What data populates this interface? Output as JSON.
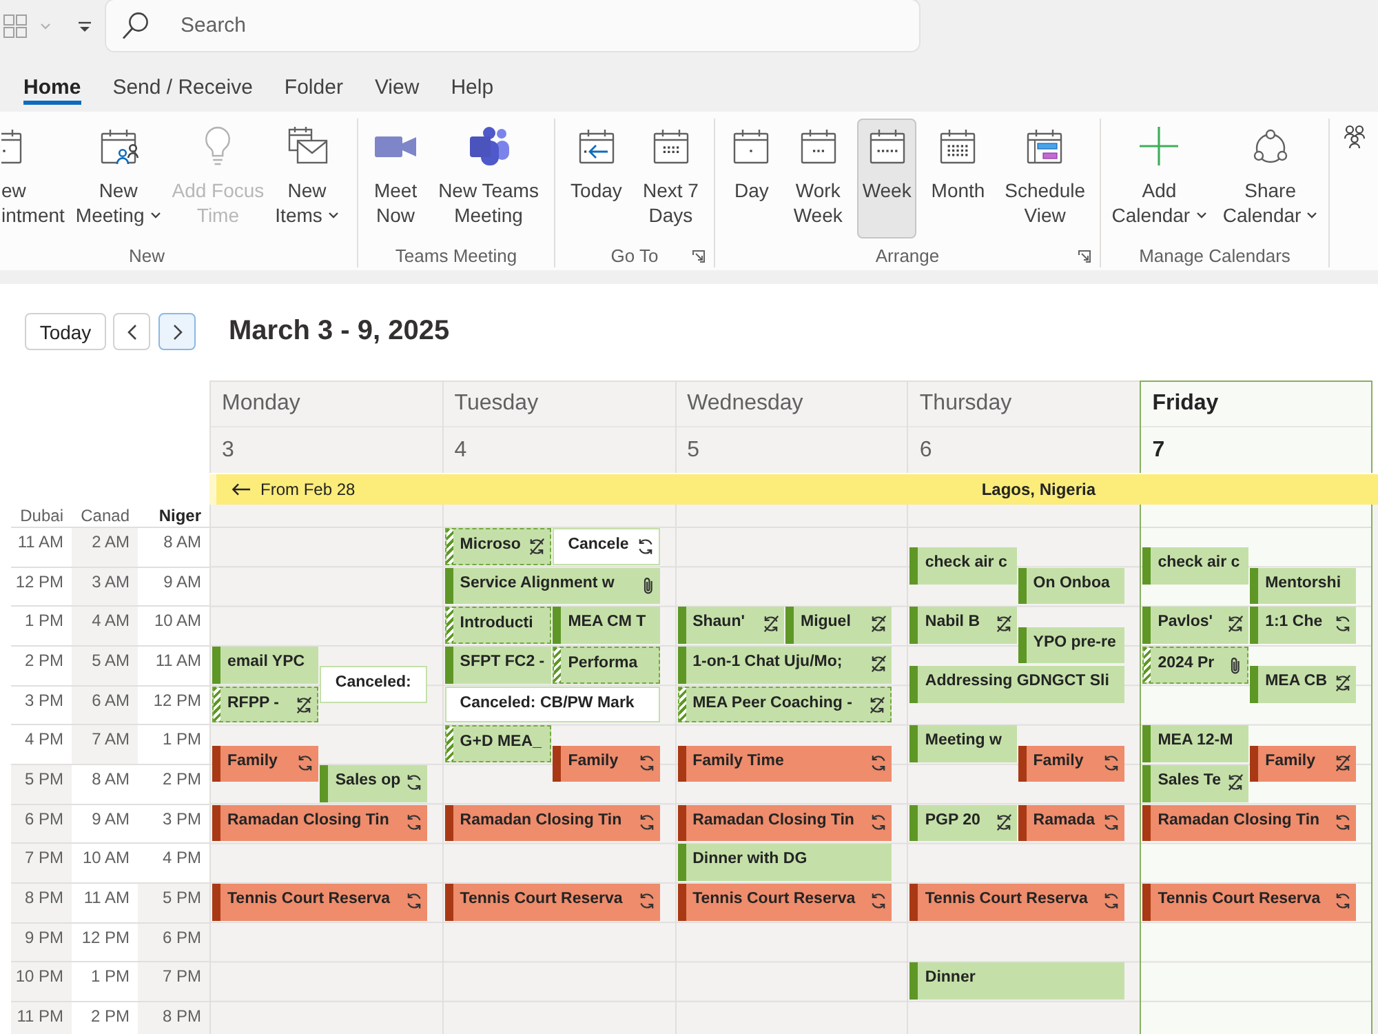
{
  "top_bar": {
    "search": {
      "placeholder": "Search"
    }
  },
  "tabs": [
    {
      "label": "Home",
      "selected": true
    },
    {
      "label": "Send / Receive",
      "selected": false
    },
    {
      "label": "Folder",
      "selected": false
    },
    {
      "label": "View",
      "selected": false
    },
    {
      "label": "Help",
      "selected": false
    }
  ],
  "ribbon": {
    "groups": [
      {
        "label": "New",
        "launcher": false,
        "buttons": [
          {
            "lines": [
              "ew",
              "intment"
            ],
            "dropdown": false,
            "disabled": false
          },
          {
            "lines": [
              "New",
              "Meeting"
            ],
            "dropdown": true,
            "disabled": false
          },
          {
            "lines": [
              "Add Focus",
              "Time"
            ],
            "dropdown": false,
            "disabled": true
          },
          {
            "lines": [
              "New",
              "Items"
            ],
            "dropdown": true,
            "disabled": false
          }
        ]
      },
      {
        "label": "Teams Meeting",
        "launcher": false,
        "buttons": [
          {
            "lines": [
              "Meet",
              "Now"
            ],
            "dropdown": false,
            "disabled": false
          },
          {
            "lines": [
              "New Teams",
              "Meeting"
            ],
            "dropdown": false,
            "disabled": false
          }
        ]
      },
      {
        "label": "Go To",
        "launcher": true,
        "buttons": [
          {
            "lines": [
              "Today"
            ],
            "dropdown": false,
            "disabled": false
          },
          {
            "lines": [
              "Next 7",
              "Days"
            ],
            "dropdown": false,
            "disabled": false
          }
        ]
      },
      {
        "label": "Arrange",
        "launcher": true,
        "buttons": [
          {
            "lines": [
              "Day"
            ],
            "dropdown": false,
            "disabled": false,
            "selected": false
          },
          {
            "lines": [
              "Work",
              "Week"
            ],
            "dropdown": false,
            "disabled": false,
            "selected": false
          },
          {
            "lines": [
              "Week"
            ],
            "dropdown": false,
            "disabled": false,
            "selected": true
          },
          {
            "lines": [
              "Month"
            ],
            "dropdown": false,
            "disabled": false,
            "selected": false
          },
          {
            "lines": [
              "Schedule",
              "View"
            ],
            "dropdown": false,
            "disabled": false,
            "selected": false
          }
        ]
      },
      {
        "label": "Manage Calendars",
        "launcher": false,
        "buttons": [
          {
            "lines": [
              "Add",
              "Calendar"
            ],
            "dropdown": true,
            "disabled": false
          },
          {
            "lines": [
              "Share",
              "Calendar"
            ],
            "dropdown": true,
            "disabled": false
          }
        ]
      }
    ]
  },
  "calendar": {
    "nav": {
      "today": "Today",
      "arrows": [
        {
          "kind": "previous",
          "highlighted": false
        },
        {
          "kind": "next",
          "highlighted": true
        }
      ]
    },
    "title": "March 3 - 9, 2025",
    "all_day_events": [
      {
        "continued_label": "From Feb 28",
        "title": "Lagos, Nigeria",
        "color": "#fcec7a"
      }
    ],
    "time_zones": [
      {
        "name": "Dubai",
        "primary": false,
        "hours": [
          {
            "label": "11 AM",
            "working": true
          },
          {
            "label": "12 PM",
            "working": true
          },
          {
            "label": "1 PM",
            "working": true
          },
          {
            "label": "2 PM",
            "working": true
          },
          {
            "label": "3 PM",
            "working": true
          },
          {
            "label": "4 PM",
            "working": true
          },
          {
            "label": "5 PM",
            "working": false
          },
          {
            "label": "6 PM",
            "working": false
          },
          {
            "label": "7 PM",
            "working": false
          },
          {
            "label": "8 PM",
            "working": false
          },
          {
            "label": "9 PM",
            "working": false
          },
          {
            "label": "10 PM",
            "working": false
          },
          {
            "label": "11 PM",
            "working": false
          }
        ]
      },
      {
        "name": "Canad",
        "primary": false,
        "hours": [
          {
            "label": "2 AM",
            "working": false
          },
          {
            "label": "3 AM",
            "working": false
          },
          {
            "label": "4 AM",
            "working": false
          },
          {
            "label": "5 AM",
            "working": false
          },
          {
            "label": "6 AM",
            "working": false
          },
          {
            "label": "7 AM",
            "working": false
          },
          {
            "label": "8 AM",
            "working": true
          },
          {
            "label": "9 AM",
            "working": true
          },
          {
            "label": "10 AM",
            "working": true
          },
          {
            "label": "11 AM",
            "working": true
          },
          {
            "label": "12 PM",
            "working": true
          },
          {
            "label": "1 PM",
            "working": true
          },
          {
            "label": "2 PM",
            "working": true
          }
        ]
      },
      {
        "name": "Niger",
        "primary": true,
        "hours": [
          {
            "label": "8 AM",
            "working": true
          },
          {
            "label": "9 AM",
            "working": true
          },
          {
            "label": "10 AM",
            "working": true
          },
          {
            "label": "11 AM",
            "working": true
          },
          {
            "label": "12 PM",
            "working": true
          },
          {
            "label": "1 PM",
            "working": true
          },
          {
            "label": "2 PM",
            "working": true
          },
          {
            "label": "3 PM",
            "working": true
          },
          {
            "label": "4 PM",
            "working": true
          },
          {
            "label": "5 PM",
            "working": false
          },
          {
            "label": "6 PM",
            "working": false
          },
          {
            "label": "7 PM",
            "working": false
          },
          {
            "label": "8 PM",
            "working": false
          }
        ]
      }
    ],
    "days": [
      {
        "name": "Monday",
        "date": "3",
        "today": false,
        "events": [
          {
            "title": "email YPC",
            "kind": "busy",
            "color": "#c4e0a8"
          },
          {
            "title": "Canceled:",
            "kind": "canceled",
            "color": "#c4e0a8"
          },
          {
            "title": "RFPP -",
            "kind": "tentative",
            "color": "#c4e0a8",
            "exception": true
          },
          {
            "title": "Family",
            "kind": "busy",
            "color": "#ee8c6c",
            "recurring": true
          },
          {
            "title": "Sales op",
            "kind": "busy",
            "color": "#c4e0a8",
            "recurring": true
          },
          {
            "title": "Ramadan Closing Tin",
            "kind": "busy",
            "color": "#ee8c6c",
            "recurring": true
          },
          {
            "title": "Tennis Court Reserva",
            "kind": "busy",
            "color": "#ee8c6c",
            "recurring": true
          }
        ]
      },
      {
        "name": "Tuesday",
        "date": "4",
        "today": false,
        "events": [
          {
            "title": "Microso",
            "kind": "tentative",
            "color": "#c4e0a8",
            "exception": true
          },
          {
            "title": "Cancele",
            "kind": "canceled",
            "color": "#c4e0a8",
            "recurring": true
          },
          {
            "title": "Service Alignment w",
            "kind": "busy",
            "color": "#c4e0a8",
            "attachment": true
          },
          {
            "title": "Introducti",
            "kind": "tentative",
            "color": "#c4e0a8"
          },
          {
            "title": "MEA CM T",
            "kind": "busy",
            "color": "#c4e0a8"
          },
          {
            "title": "SFPT FC2 -",
            "kind": "busy",
            "color": "#c4e0a8"
          },
          {
            "title": "Performa",
            "kind": "tentative",
            "color": "#c4e0a8"
          },
          {
            "title": "Canceled: CB/PW Mark",
            "kind": "canceled",
            "color": "#c4e0a8"
          },
          {
            "title": "G+D MEA_",
            "kind": "tentative",
            "color": "#c4e0a8"
          },
          {
            "title": "Family",
            "kind": "busy",
            "color": "#ee8c6c",
            "recurring": true
          },
          {
            "title": "Ramadan Closing Tin",
            "kind": "busy",
            "color": "#ee8c6c",
            "recurring": true
          },
          {
            "title": "Tennis Court Reserva",
            "kind": "busy",
            "color": "#ee8c6c",
            "recurring": true
          }
        ]
      },
      {
        "name": "Wednesday",
        "date": "5",
        "today": false,
        "events": [
          {
            "title": "Shaun'",
            "kind": "busy",
            "color": "#c4e0a8",
            "exception": true
          },
          {
            "title": "Miguel",
            "kind": "busy",
            "color": "#c4e0a8",
            "exception": true
          },
          {
            "title": "1-on-1 Chat Uju/Mo;",
            "kind": "busy",
            "color": "#c4e0a8",
            "exception": true
          },
          {
            "title": "MEA Peer Coaching -",
            "kind": "tentative",
            "color": "#c4e0a8",
            "exception": true
          },
          {
            "title": "Family Time",
            "kind": "busy",
            "color": "#ee8c6c",
            "recurring": true
          },
          {
            "title": "Ramadan Closing Tin",
            "kind": "busy",
            "color": "#ee8c6c",
            "recurring": true
          },
          {
            "title": "Dinner with DG",
            "kind": "busy",
            "color": "#c4e0a8"
          },
          {
            "title": "Tennis Court Reserva",
            "kind": "busy",
            "color": "#ee8c6c",
            "recurring": true
          }
        ]
      },
      {
        "name": "Thursday",
        "date": "6",
        "today": false,
        "events": [
          {
            "title": "check air c",
            "kind": "busy",
            "color": "#c4e0a8"
          },
          {
            "title": "On Onboa",
            "kind": "busy",
            "color": "#c4e0a8"
          },
          {
            "title": "Nabil B",
            "kind": "busy",
            "color": "#c4e0a8",
            "exception": true
          },
          {
            "title": "YPO pre-re",
            "kind": "busy",
            "color": "#c4e0a8"
          },
          {
            "title": "Addressing GDNGCT Sli",
            "kind": "busy",
            "color": "#c4e0a8"
          },
          {
            "title": "Meeting w",
            "kind": "busy",
            "color": "#c4e0a8"
          },
          {
            "title": "Family",
            "kind": "busy",
            "color": "#ee8c6c",
            "recurring": true
          },
          {
            "title": "PGP 20",
            "kind": "busy",
            "color": "#c4e0a8",
            "exception": true
          },
          {
            "title": "Ramada",
            "kind": "busy",
            "color": "#ee8c6c",
            "recurring": true
          },
          {
            "title": "Tennis Court Reserva",
            "kind": "busy",
            "color": "#ee8c6c",
            "recurring": true
          },
          {
            "title": "Dinner",
            "kind": "busy",
            "color": "#c4e0a8"
          }
        ]
      },
      {
        "name": "Friday",
        "date": "7",
        "today": true,
        "events": [
          {
            "title": "check air c",
            "kind": "busy",
            "color": "#c4e0a8"
          },
          {
            "title": "Mentorshi",
            "kind": "busy",
            "color": "#c4e0a8"
          },
          {
            "title": "Pavlos'",
            "kind": "busy",
            "color": "#c4e0a8",
            "exception": true
          },
          {
            "title": "1:1 Che",
            "kind": "busy",
            "color": "#c4e0a8",
            "recurring": true
          },
          {
            "title": "2024 Pr",
            "kind": "tentative",
            "color": "#c4e0a8",
            "attachment": true
          },
          {
            "title": "MEA CB",
            "kind": "busy",
            "color": "#c4e0a8",
            "exception": true
          },
          {
            "title": "MEA 12-M",
            "kind": "busy",
            "color": "#c4e0a8"
          },
          {
            "title": "Family",
            "kind": "busy",
            "color": "#ee8c6c",
            "exception": true
          },
          {
            "title": "Sales Te",
            "kind": "busy",
            "color": "#c4e0a8",
            "exception": true
          },
          {
            "title": "Ramadan Closing Tin",
            "kind": "busy",
            "color": "#ee8c6c",
            "recurring": true
          },
          {
            "title": "Tennis Court Reserva",
            "kind": "busy",
            "color": "#ee8c6c",
            "recurring": true
          }
        ]
      }
    ]
  }
}
